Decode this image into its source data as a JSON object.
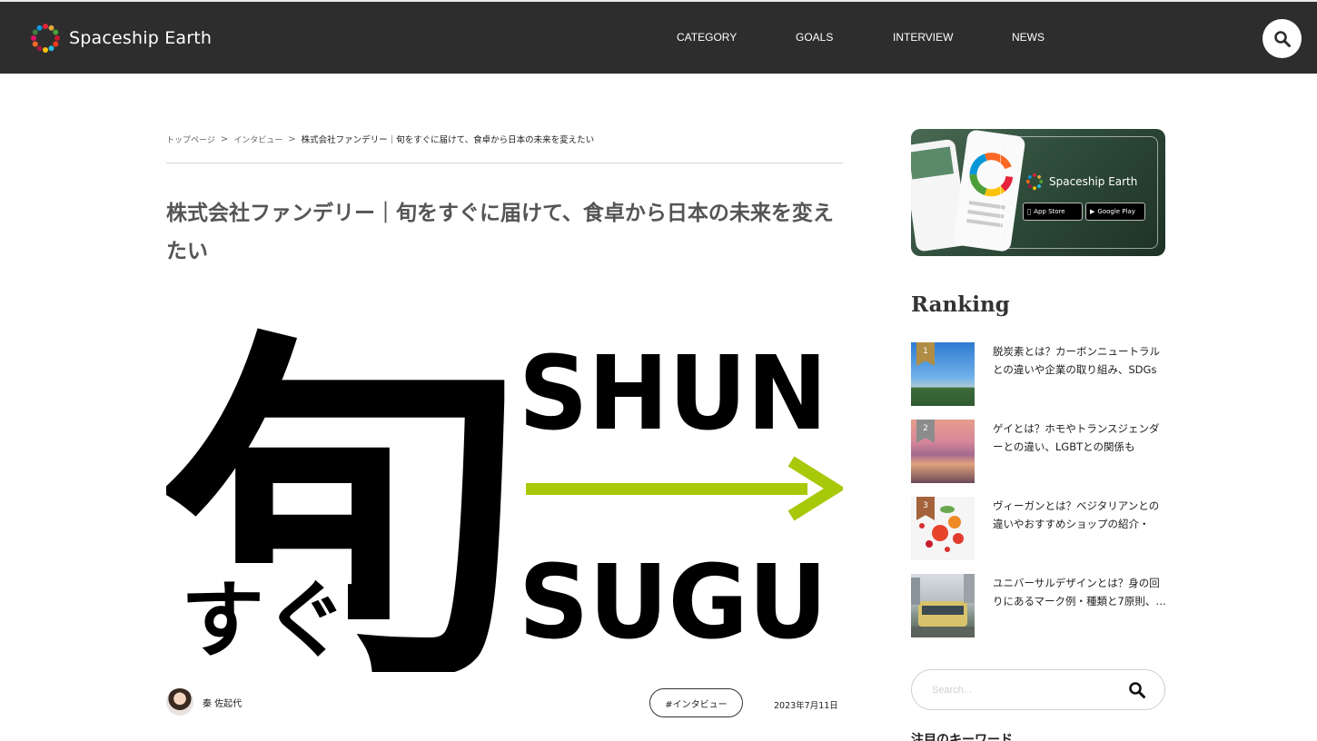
{
  "header": {
    "logo_text": "Spaceship Earth",
    "nav": [
      "CATEGORY",
      "GOALS",
      "INTERVIEW",
      "NEWS"
    ]
  },
  "breadcrumb": {
    "home": "トップページ",
    "section": "インタビュー",
    "current": "株式会社ファンデリー｜旬をすぐに届けて、食卓から日本の未来を変えたい"
  },
  "article": {
    "title": "株式会社ファンデリー｜旬をすぐに届けて、食卓から日本の未来を変えたい",
    "hero": {
      "kanji": "旬",
      "kana": "すぐ",
      "word_top": "SHUN",
      "word_bottom": "SUGU",
      "arrow_color": "#a8c80a"
    },
    "author": "秦 佐起代",
    "tag": "#インタビュー",
    "date": "2023年7月11日"
  },
  "sidebar": {
    "banner": {
      "logo_text": "Spaceship Earth",
      "app_store": "App Store",
      "google_play": "Google Play"
    },
    "ranking_title": "Ranking",
    "ranking": [
      {
        "rank": "1",
        "text": "脱炭素とは？カーボンニュートラルとの違いや企業の取り組み、SDGsと…"
      },
      {
        "rank": "2",
        "text": "ゲイとは？ホモやトランスジェンダーとの違い、LGBTとの関係も"
      },
      {
        "rank": "3",
        "text": "ヴィーガンとは？ベジタリアンとの違いやおすすめショップの紹介・SDG…"
      },
      {
        "rank": "",
        "text": "ユニバーサルデザインとは？身の回りにあるマーク例・種類と7原則、…"
      }
    ],
    "search_placeholder": "Search...",
    "keywords_title": "注目のキーワード"
  },
  "colors": {
    "header_bg": "#2d2d2d",
    "accent_green": "#a8c80a"
  }
}
